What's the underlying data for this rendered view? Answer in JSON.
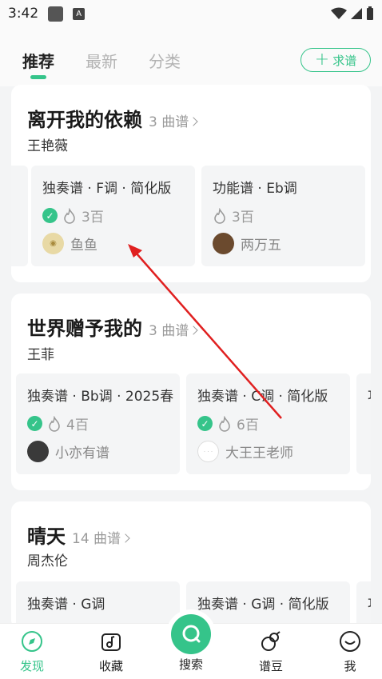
{
  "status": {
    "time": "3:42"
  },
  "tabs": [
    {
      "label": "推荐"
    },
    {
      "label": "最新"
    },
    {
      "label": "分类"
    }
  ],
  "request_button": {
    "label": "求谱"
  },
  "sections": [
    {
      "title": "离开我的依赖",
      "count": "3 曲谱",
      "artist": "王艳薇",
      "sheets": [
        {
          "title": "独奏谱 · F调 · 简化版",
          "heat": "3百",
          "author": "鱼鱼",
          "verified": true
        },
        {
          "title": "功能谱 · Eb调",
          "heat": "3百",
          "author": "两万五",
          "verified": false
        }
      ]
    },
    {
      "title": "世界赠予我的",
      "count": "3 曲谱",
      "artist": "王菲",
      "sheets": [
        {
          "title": "独奏谱 · Bb调 · 2025春",
          "heat": "4百",
          "author": "小亦有谱",
          "verified": true
        },
        {
          "title": "独奏谱 · C调 · 简化版",
          "heat": "6百",
          "author": "大王王老师",
          "verified": true
        },
        {
          "title": "功",
          "heat": "",
          "author": "",
          "verified": false
        }
      ]
    },
    {
      "title": "晴天",
      "count": "14 曲谱",
      "artist": "周杰伦",
      "sheets": [
        {
          "title": "独奏谱 · G调",
          "heat": "",
          "author": "",
          "verified": false
        },
        {
          "title": "独奏谱 · G调 · 简化版",
          "heat": "",
          "author": "",
          "verified": false
        },
        {
          "title": "功",
          "heat": "",
          "author": "",
          "verified": false
        }
      ]
    }
  ],
  "bottom_nav": [
    {
      "label": "发现",
      "icon": "compass-icon",
      "active": true
    },
    {
      "label": "收藏",
      "icon": "music-note-icon",
      "active": false
    },
    {
      "label": "搜索",
      "icon": "search-icon",
      "active": false
    },
    {
      "label": "谱豆",
      "icon": "bean-icon",
      "active": false
    },
    {
      "label": "我",
      "icon": "smile-icon",
      "active": false
    }
  ],
  "colors": {
    "accent": "#35c48a",
    "annotation_arrow": "#e02020"
  }
}
